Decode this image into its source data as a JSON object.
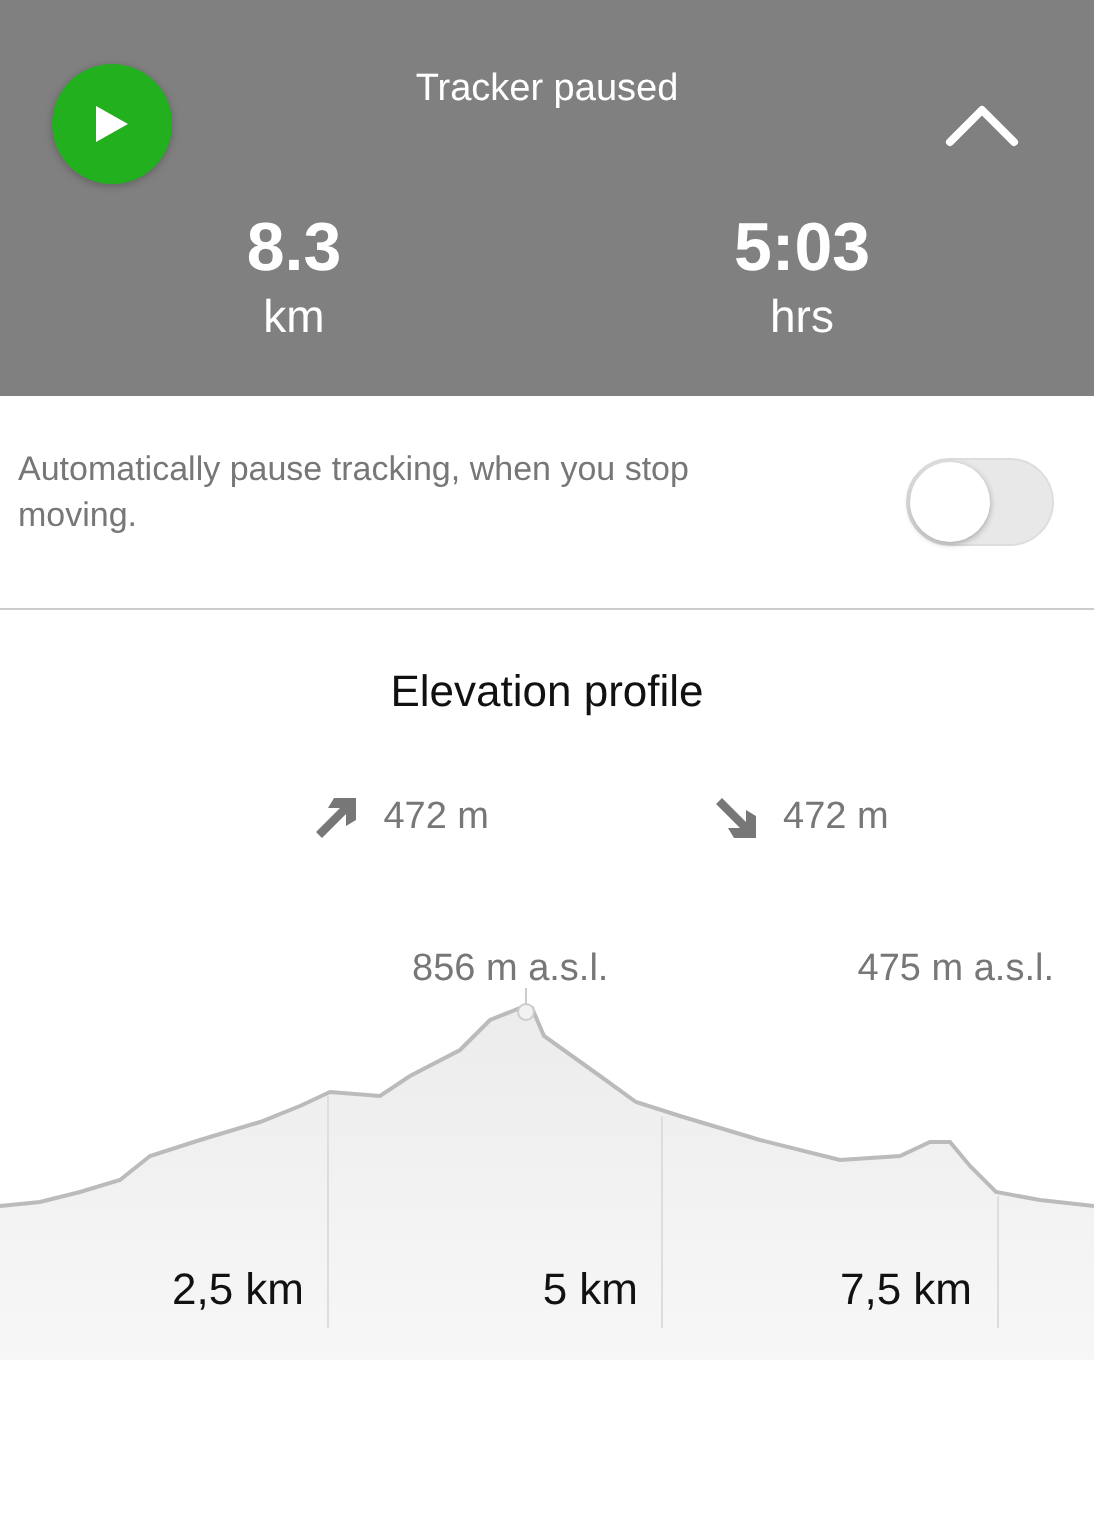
{
  "header": {
    "status": "Tracker paused",
    "tracking": false,
    "expanded": false
  },
  "stats": [
    {
      "value": "8.3",
      "unit": "km"
    },
    {
      "value": "5:03",
      "unit": "hrs"
    }
  ],
  "auto_pause": {
    "text": "Automatically pause tracking, when you stop moving.",
    "on": false
  },
  "elevation": {
    "title": "Elevation profile",
    "ascent": "472 m",
    "descent": "472 m",
    "peak_label": "856 m a.s.l.",
    "end_label": "475 m a.s.l.",
    "distance_labels": [
      "2,5 km",
      "5 km",
      "7,5 km"
    ]
  }
}
